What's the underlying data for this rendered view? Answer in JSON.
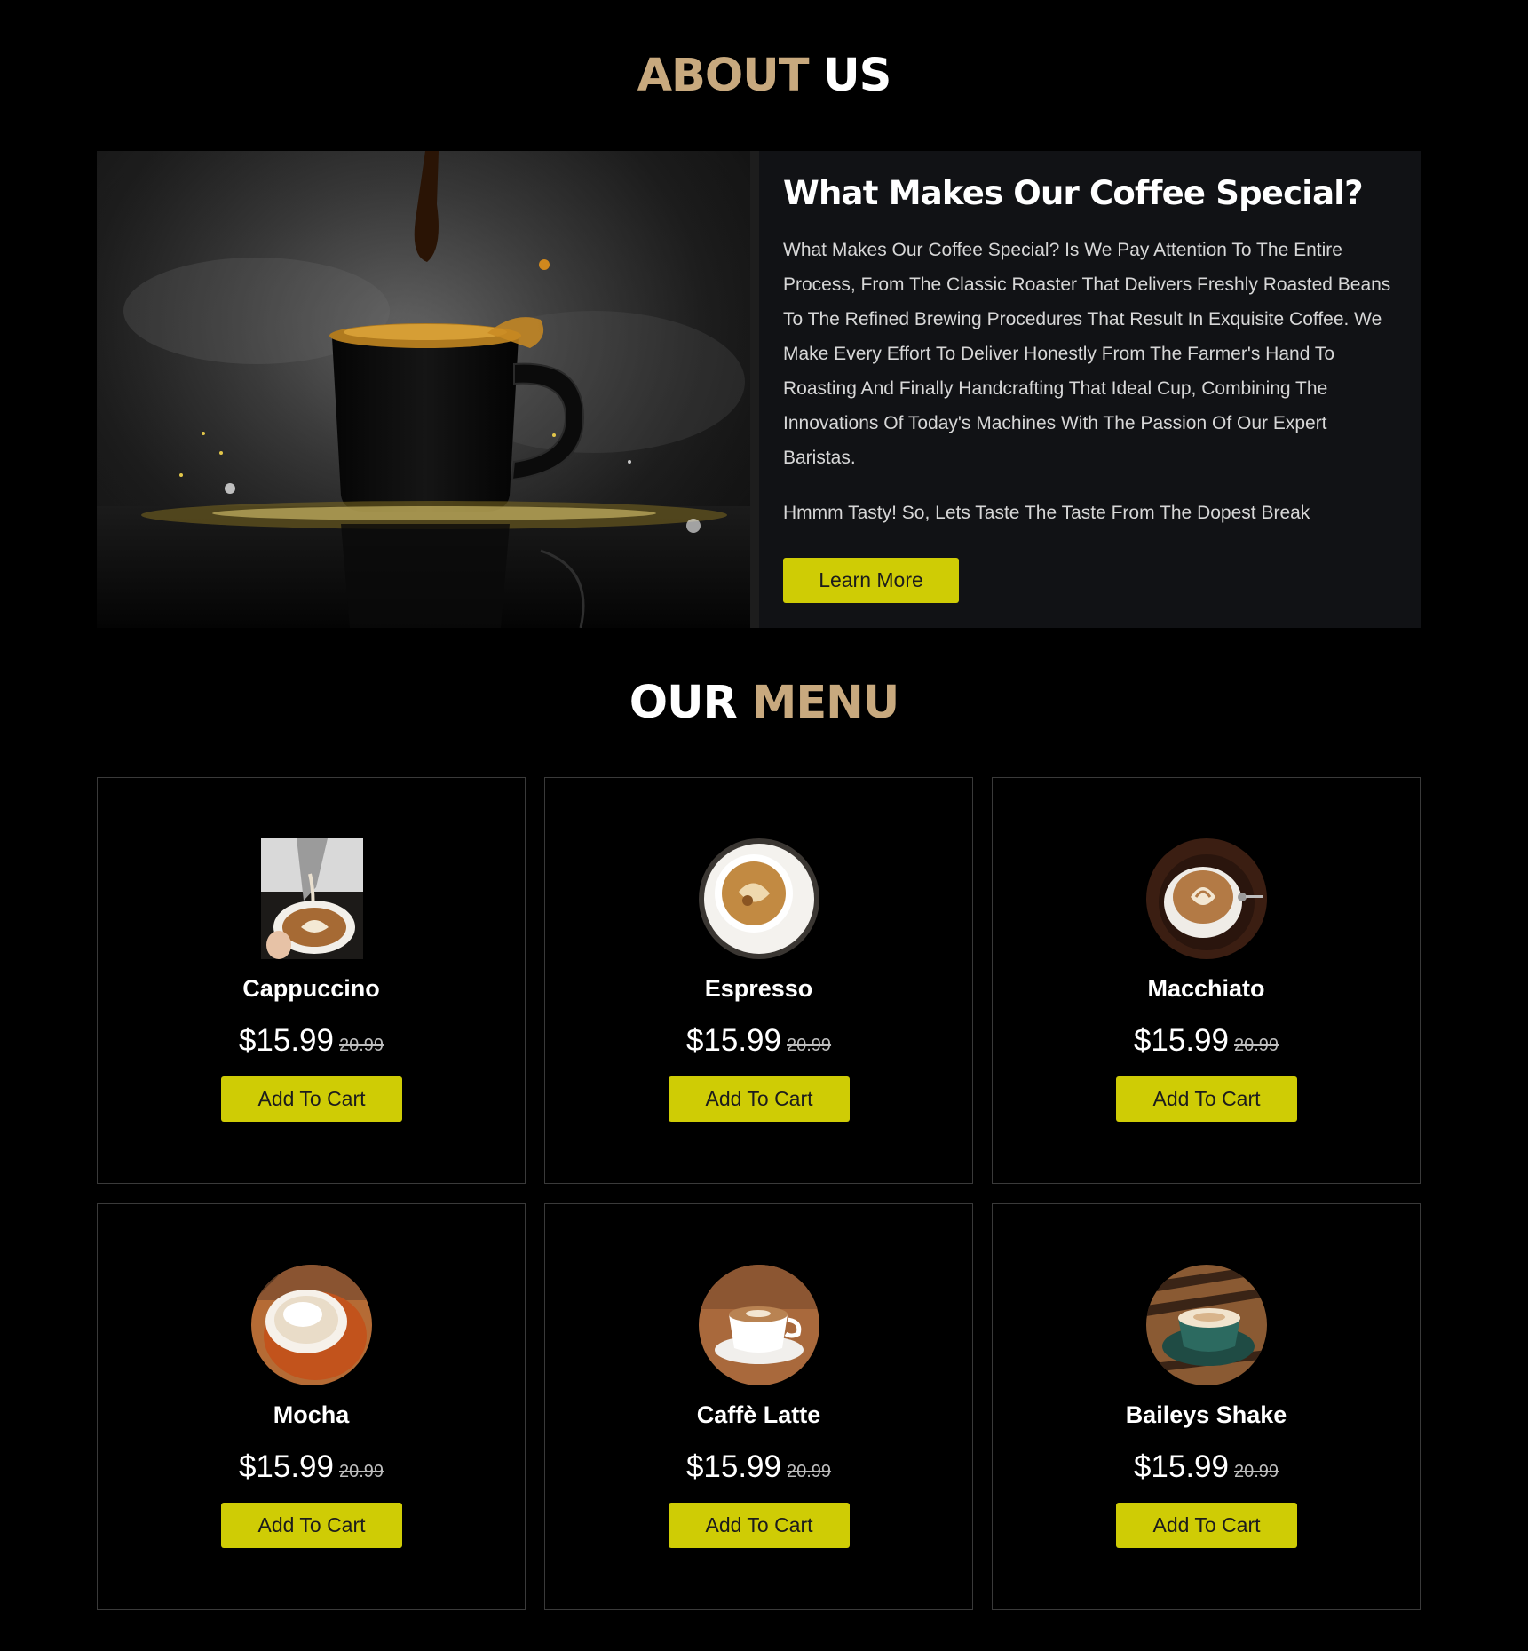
{
  "colors": {
    "background": "#000000",
    "accent_heading": "#c8a97e",
    "button": "#cfcc05",
    "panel": "#111215"
  },
  "about": {
    "heading_accent": "ABOUT",
    "heading_plain": "US",
    "title": "What Makes Our Coffee Special?",
    "body": "What Makes Our Coffee Special? Is We Pay Attention To The Entire Process, From The Classic Roaster That Delivers Freshly Roasted Beans To The Refined Brewing Procedures That Result In Exquisite Coffee. We Make Every Effort To Deliver Honestly From The Farmer's Hand To Roasting And Finally Handcrafting That Ideal Cup, Combining The Innovations Of Today's Machines With The Passion Of Our Expert Baristas.",
    "tagline": "Hmmm Tasty! So, Lets Taste The Taste From The Dopest Break",
    "button_label": "Learn More"
  },
  "menu": {
    "heading_plain": "OUR",
    "heading_accent": "MENU",
    "items": [
      {
        "name": "Cappuccino",
        "price": "$15.99",
        "old_price": "20.99",
        "button_label": "Add To Cart"
      },
      {
        "name": "Espresso",
        "price": "$15.99",
        "old_price": "20.99",
        "button_label": "Add To Cart"
      },
      {
        "name": "Macchiato",
        "price": "$15.99",
        "old_price": "20.99",
        "button_label": "Add To Cart"
      },
      {
        "name": "Mocha",
        "price": "$15.99",
        "old_price": "20.99",
        "button_label": "Add To Cart"
      },
      {
        "name": "Caffè Latte",
        "price": "$15.99",
        "old_price": "20.99",
        "button_label": "Add To Cart"
      },
      {
        "name": "Baileys Shake",
        "price": "$15.99",
        "old_price": "20.99",
        "button_label": "Add To Cart"
      }
    ]
  }
}
